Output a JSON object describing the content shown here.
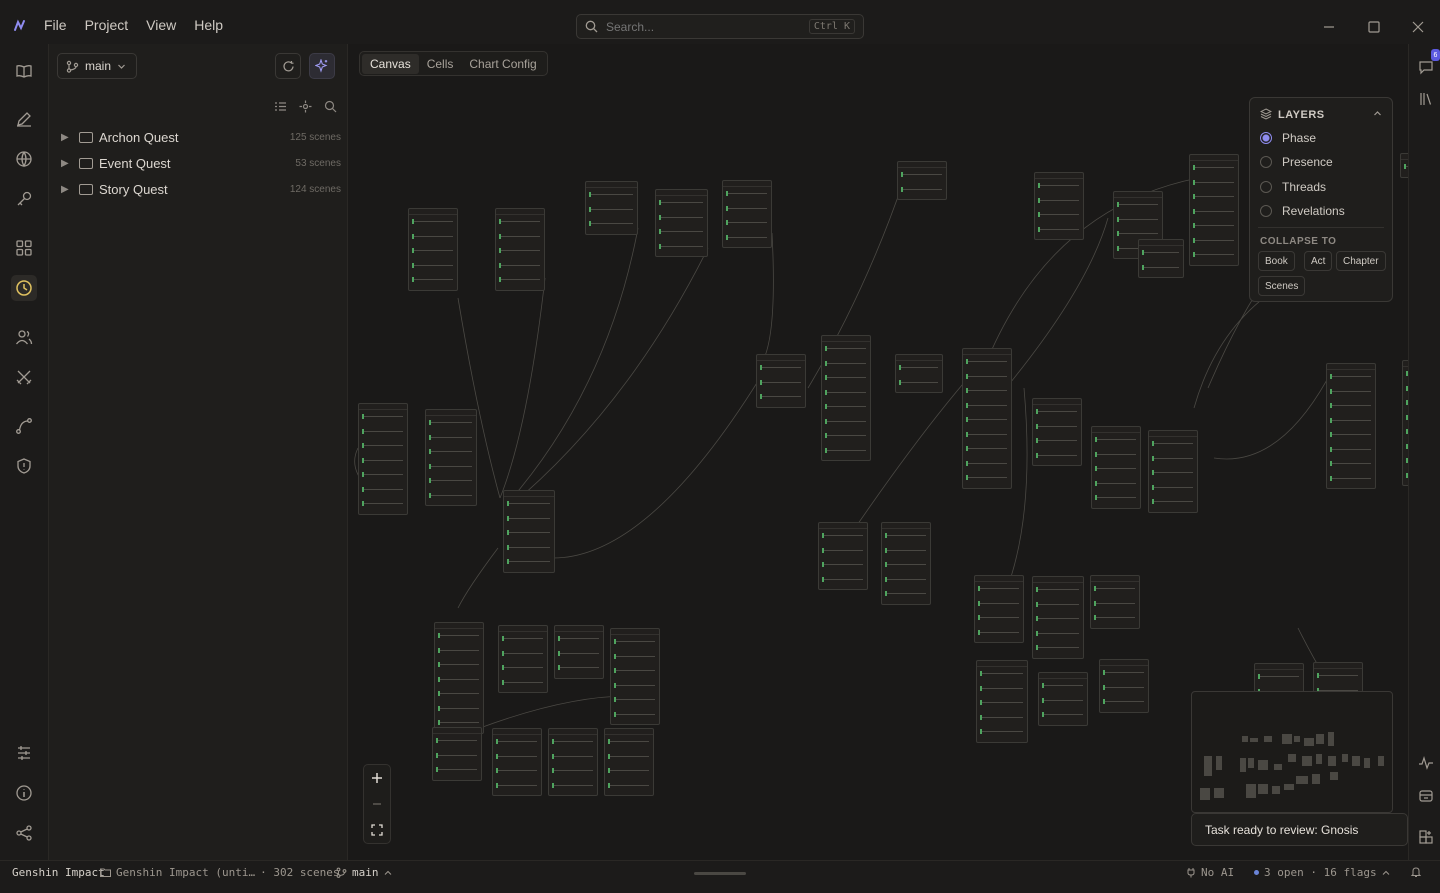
{
  "menu": [
    "File",
    "Project",
    "View",
    "Help"
  ],
  "search": {
    "placeholder": "Search...",
    "shortcut": "Ctrl K"
  },
  "sidebar": {
    "branch": "main",
    "tree": [
      {
        "name": "Archon Quest",
        "count": "125 scenes"
      },
      {
        "name": "Event Quest",
        "count": "53 scenes"
      },
      {
        "name": "Story Quest",
        "count": "124 scenes"
      }
    ]
  },
  "tabs": [
    "Canvas",
    "Cells",
    "Chart Config"
  ],
  "layers": {
    "title": "LAYERS",
    "options": [
      "Phase",
      "Presence",
      "Threads",
      "Revelations"
    ],
    "selected": "Phase",
    "collapse_label": "COLLAPSE TO",
    "collapse_options": [
      "Book",
      "Act",
      "Chapter",
      "Scenes"
    ]
  },
  "toast": "Task ready to review: Gnosis",
  "badge": "6",
  "status": {
    "project": "Genshin Impact",
    "path": "Genshin Impact (unti…",
    "scenes": "· 302 scenes",
    "branch": "main",
    "ai": "No AI",
    "open": "3 open · 16 flags"
  },
  "colors": {
    "accent": "#8f8cf0",
    "node_marker": "#4fa45f",
    "badge": "#5c5ae0"
  }
}
